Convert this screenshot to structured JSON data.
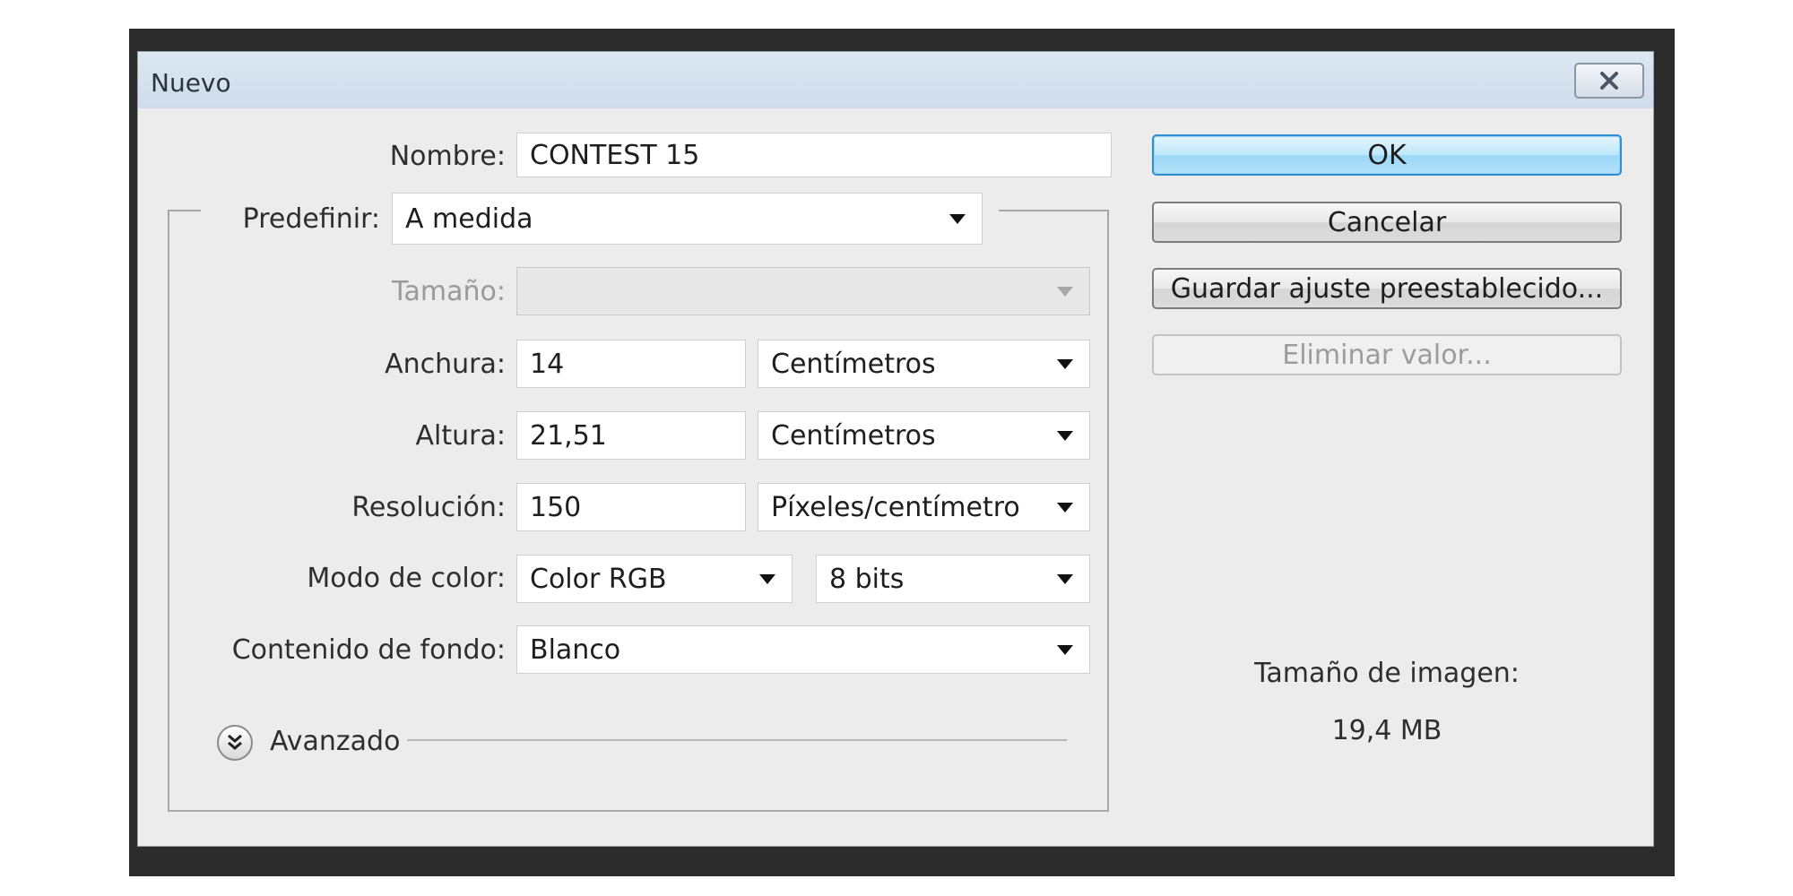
{
  "dialog": {
    "title": "Nuevo"
  },
  "form": {
    "nombre": {
      "label": "Nombre:",
      "value": "CONTEST 15"
    },
    "predefinir": {
      "label": "Predefinir:",
      "value": "A medida"
    },
    "tamano": {
      "label": "Tamaño:",
      "value": ""
    },
    "anchura": {
      "label": "Anchura:",
      "value": "14",
      "unit": "Centímetros"
    },
    "altura": {
      "label": "Altura:",
      "value": "21,51",
      "unit": "Centímetros"
    },
    "resolucion": {
      "label": "Resolución:",
      "value": "150",
      "unit": "Píxeles/centímetro"
    },
    "modo_color": {
      "label": "Modo de color:",
      "value": "Color RGB",
      "bits": "8 bits"
    },
    "contenido_fondo": {
      "label": "Contenido de fondo:",
      "value": "Blanco"
    },
    "avanzado": {
      "label": "Avanzado"
    }
  },
  "buttons": {
    "ok": "OK",
    "cancelar": "Cancelar",
    "guardar": "Guardar ajuste preestablecido...",
    "eliminar": "Eliminar valor..."
  },
  "image_size": {
    "label": "Tamaño de imagen:",
    "value": "19,4 MB"
  },
  "icons": {
    "close": "close-icon",
    "dropdown": "chevron-down-icon",
    "advanced": "double-chevron-down-icon"
  },
  "colors": {
    "ok_accent": "#2f8fd4",
    "titlebar": "#dce7f3"
  }
}
